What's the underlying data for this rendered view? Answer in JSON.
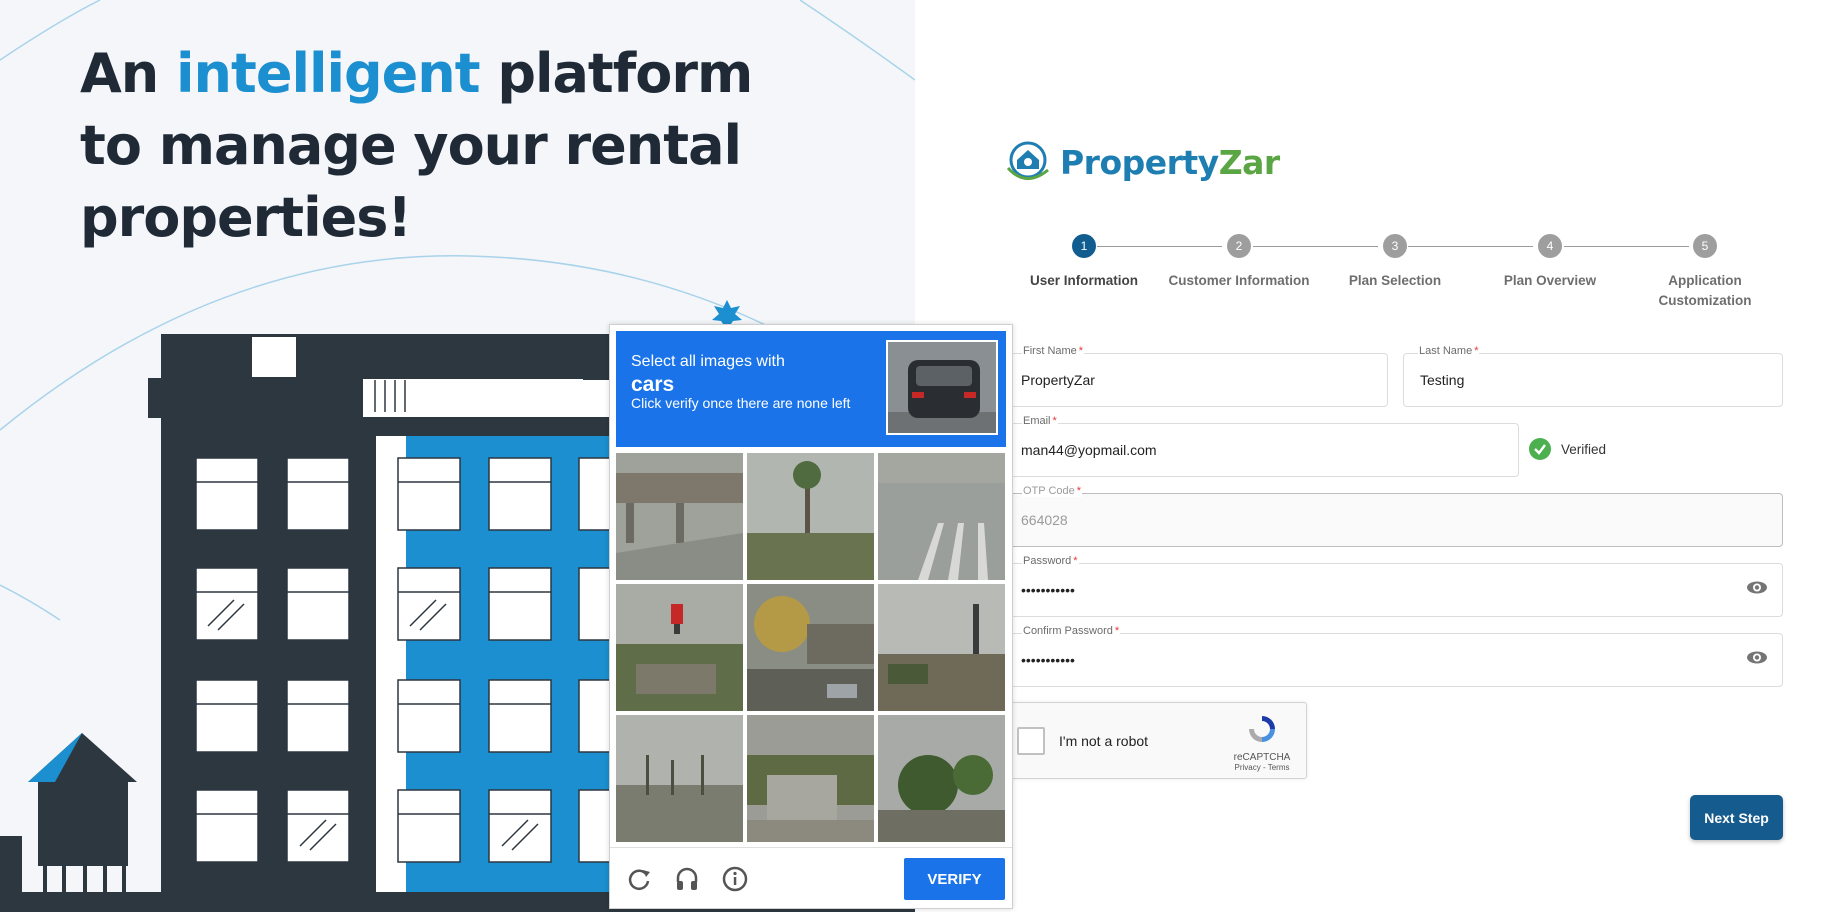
{
  "hero": {
    "headline_part1": "An ",
    "headline_accent": "intelligent",
    "headline_part2": " platform to manage your rental properties!"
  },
  "brand": {
    "name_part1": "Property",
    "name_part2": "Zar",
    "colors": {
      "blue": "#1e7eb2",
      "green": "#5aa544"
    }
  },
  "stepper": {
    "steps": [
      {
        "number": "1",
        "label": "User Information",
        "active": true
      },
      {
        "number": "2",
        "label": "Customer Information",
        "active": false
      },
      {
        "number": "3",
        "label": "Plan Selection",
        "active": false
      },
      {
        "number": "4",
        "label": "Plan Overview",
        "active": false
      },
      {
        "number": "5",
        "label": "Application Customization",
        "active": false
      }
    ]
  },
  "form": {
    "first_name": {
      "label": "First Name",
      "required": "*",
      "value": "PropertyZar"
    },
    "last_name": {
      "label": "Last Name",
      "required": "*",
      "value": "Testing"
    },
    "email": {
      "label": "Email",
      "required": "*",
      "value": "man44@yopmail.com",
      "status": "Verified"
    },
    "otp": {
      "label": "OTP Code",
      "required": "*",
      "value": "664028"
    },
    "password": {
      "label": "Password",
      "required": "*",
      "value": "•••••••••••"
    },
    "confirm_password": {
      "label": "Confirm Password",
      "required": "*",
      "value": "•••••••••••"
    },
    "next_button": "Next Step"
  },
  "recaptcha": {
    "checkbox_label": "I'm not a robot",
    "brand": "reCAPTCHA",
    "terms": "Privacy - Terms"
  },
  "challenge": {
    "instruction_line1": "Select all images with",
    "target": "cars",
    "instruction_line3": "Click verify once there are none left",
    "verify_label": "VERIFY",
    "tiles": [
      "tile-1",
      "tile-2",
      "tile-3",
      "tile-4",
      "tile-5",
      "tile-6",
      "tile-7",
      "tile-8",
      "tile-9"
    ],
    "accent_color": "#1a73e8"
  }
}
